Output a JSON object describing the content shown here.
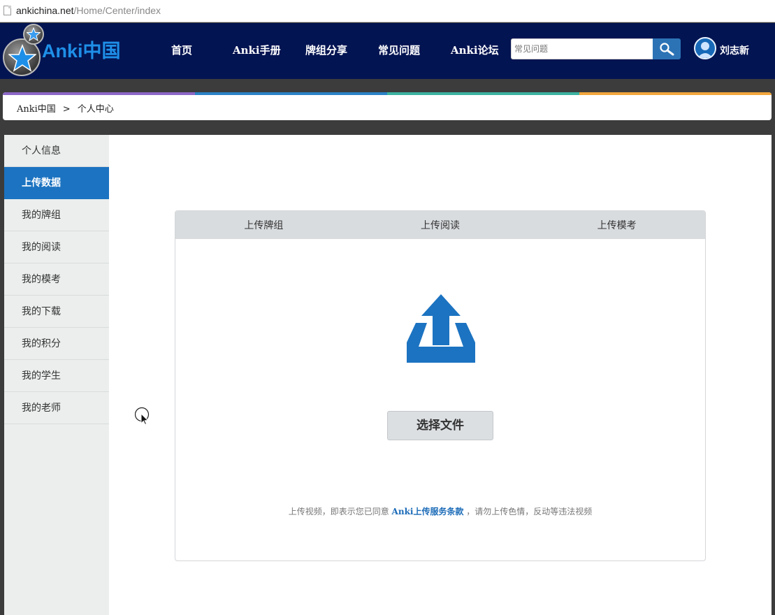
{
  "browser": {
    "url_host": "ankichina.net",
    "url_path": "/Home/Center/index"
  },
  "header": {
    "logo_text": "Anki中国",
    "nav": [
      "首页",
      "Anki手册",
      "牌组分享",
      "常见问题",
      "Anki论坛"
    ],
    "search_placeholder": "常见问题",
    "user_name": "刘志新"
  },
  "breadcrumb": {
    "home": "Anki中国",
    "separator": ">",
    "current": "个人中心"
  },
  "sidebar": {
    "items": [
      "个人信息",
      "上传数据",
      "我的牌组",
      "我的阅读",
      "我的模考",
      "我的下载",
      "我的积分",
      "我的学生",
      "我的老师"
    ],
    "active_index": 1
  },
  "upload": {
    "tabs": [
      "上传牌组",
      "上传阅读",
      "上传模考"
    ],
    "choose_file_label": "选择文件",
    "notice_prefix": "上传视频，即表示您已同意",
    "notice_link": "Anki上传服务条款",
    "notice_suffix": "，请勿上传色情，反动等违法视频"
  },
  "colors": {
    "header_bg": "#031452",
    "accent_blue": "#1c73c1",
    "colorbar": [
      "#8b67c6",
      "#2a82c6",
      "#3bb2a0",
      "#f2a63c"
    ]
  }
}
